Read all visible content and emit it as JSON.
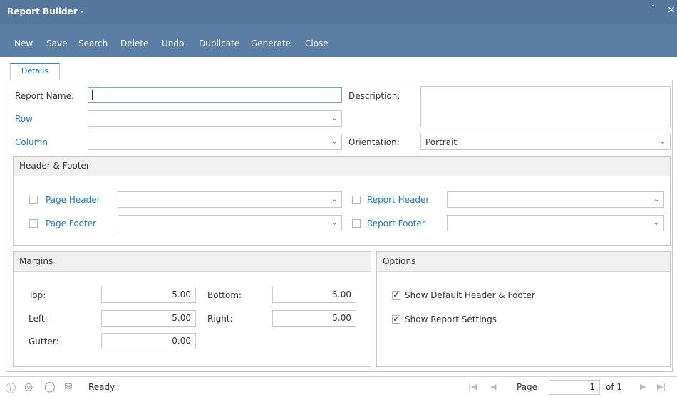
{
  "window": {
    "title": "Report Builder -"
  },
  "toolbar": {
    "new": "New",
    "save": "Save",
    "search": "Search",
    "delete": "Delete",
    "undo": "Undo",
    "duplicate": "Duplicate",
    "generate": "Generate",
    "close": "Close"
  },
  "tabs": {
    "details": "Details"
  },
  "form": {
    "report_name_label": "Report Name:",
    "report_name_value": "",
    "description_label": "Description:",
    "description_value": "",
    "row_label": "Row",
    "row_value": "",
    "column_label": "Column",
    "column_value": "",
    "orientation_label": "Orientation:",
    "orientation_value": "Portrait"
  },
  "header_footer": {
    "title": "Header & Footer",
    "page_header": "Page Header",
    "page_footer": "Page Footer",
    "report_header": "Report Header",
    "report_footer": "Report Footer"
  },
  "margins": {
    "title": "Margins",
    "top_label": "Top:",
    "top_value": "5.00",
    "bottom_label": "Bottom:",
    "bottom_value": "5.00",
    "left_label": "Left:",
    "left_value": "5.00",
    "right_label": "Right:",
    "right_value": "5.00",
    "gutter_label": "Gutter:",
    "gutter_value": "0.00"
  },
  "options": {
    "title": "Options",
    "show_default_header_footer": "Show Default Header & Footer",
    "show_default_header_footer_checked": true,
    "show_report_settings": "Show Report Settings",
    "show_report_settings_checked": true
  },
  "status": {
    "text": "Ready",
    "page_label": "Page",
    "page_value": "1",
    "of_text": "of 1"
  },
  "colors": {
    "titlebar": "#54779b",
    "toolbar": "#5b7fa4",
    "link": "#1f78c8"
  }
}
